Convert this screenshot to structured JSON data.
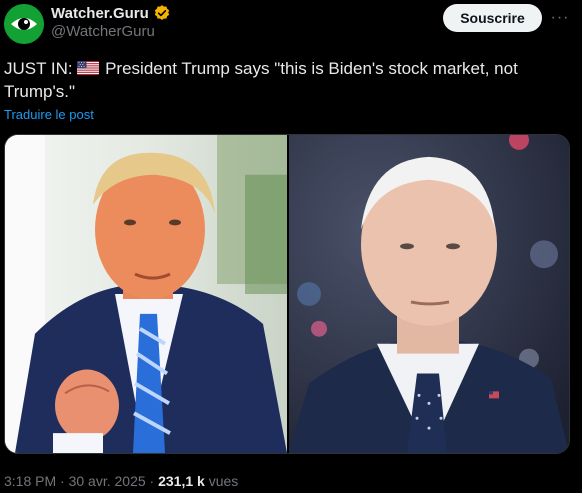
{
  "author": {
    "display_name": "Watcher.Guru",
    "handle": "@WatcherGuru",
    "avatar_icon": "eye-logo-icon",
    "verified_icon": "verified-badge-icon",
    "verified_color": "#f5b400"
  },
  "actions": {
    "follow_label": "Souscrire",
    "more_icon": "more-options-icon",
    "more_label": "···"
  },
  "post": {
    "text_prefix": "JUST IN: ",
    "flag_icon": "us-flag-icon",
    "text_body": " President Trump says \"this is Biden's stock market, not Trump's.\"",
    "translate_label": "Traduire le post"
  },
  "media": {
    "images": [
      {
        "subject": "trump-photo"
      },
      {
        "subject": "biden-photo"
      }
    ]
  },
  "footer": {
    "time": "3:18 PM",
    "date": "30 avr. 2025",
    "views_count": "231,1 k",
    "views_label": "vues"
  },
  "colors": {
    "background": "#000000",
    "text": "#e7e9ea",
    "muted": "#71767b",
    "link": "#1d9bf0",
    "button_bg": "#eff3f4"
  }
}
